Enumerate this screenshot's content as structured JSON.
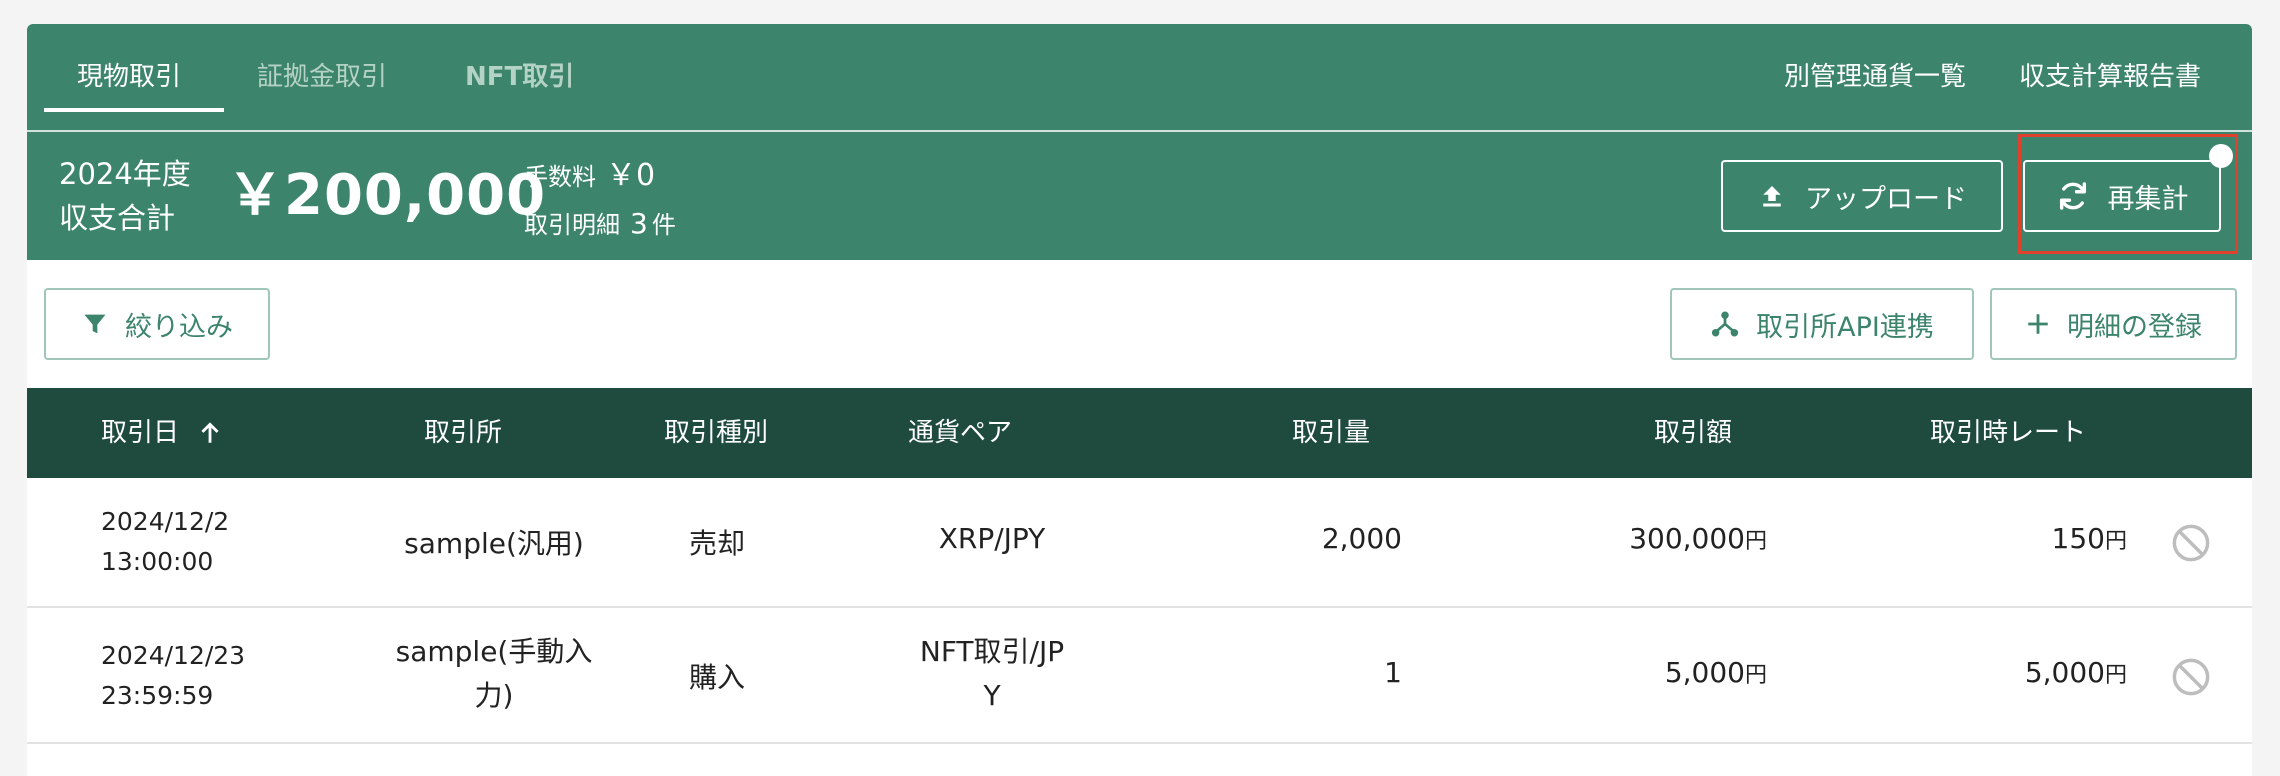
{
  "tabs": [
    {
      "label": "現物取引",
      "active": true
    },
    {
      "label": "証拠金取引",
      "active": false
    },
    {
      "label": "NFT取引",
      "active": false
    }
  ],
  "top_links": {
    "separate_currency_list": "別管理通貨一覧",
    "income_report": "収支計算報告書"
  },
  "summary": {
    "year": "2024年度",
    "label": "収支合計",
    "total": "￥200,000",
    "fee_label": "手数料",
    "fee_value": "￥0",
    "count_label": "取引明細",
    "count_value": "3",
    "count_unit": "件",
    "upload_label": "アップロード",
    "recalc_label": "再集計"
  },
  "actions": {
    "filter_label": "絞り込み",
    "api_label": "取引所API連携",
    "add_label": "明細の登録"
  },
  "table": {
    "headers": {
      "date": "取引日",
      "exchange": "取引所",
      "type": "取引種別",
      "pair": "通貨ペア",
      "amount": "取引量",
      "value": "取引額",
      "rate": "取引時レート"
    },
    "rows": [
      {
        "date_line1": "2024/12/2",
        "date_line2": "13:00:00",
        "exchange_line1": "sample(汎用)",
        "exchange_line2": "",
        "type": "売却",
        "pair_line1": "XRP/JPY",
        "pair_line2": "",
        "amount": "2,000",
        "value": "300,000",
        "value_unit": "円",
        "rate": "150",
        "rate_unit": "円"
      },
      {
        "date_line1": "2024/12/23",
        "date_line2": "23:59:59",
        "exchange_line1": "sample(手動入",
        "exchange_line2": "力)",
        "type": "購入",
        "pair_line1": "NFT取引/JP",
        "pair_line2": "Y",
        "amount": "1",
        "value": "5,000",
        "value_unit": "円",
        "rate": "5,000",
        "rate_unit": "円"
      }
    ]
  },
  "colors": {
    "brand_green": "#3d846c",
    "header_dark": "#1f4b3f",
    "highlight_red": "#e0412c"
  },
  "icons": [
    "arrow-up-icon",
    "upload-icon",
    "refresh-icon",
    "filter-icon",
    "api-network-icon",
    "plus-icon",
    "ban-icon"
  ]
}
